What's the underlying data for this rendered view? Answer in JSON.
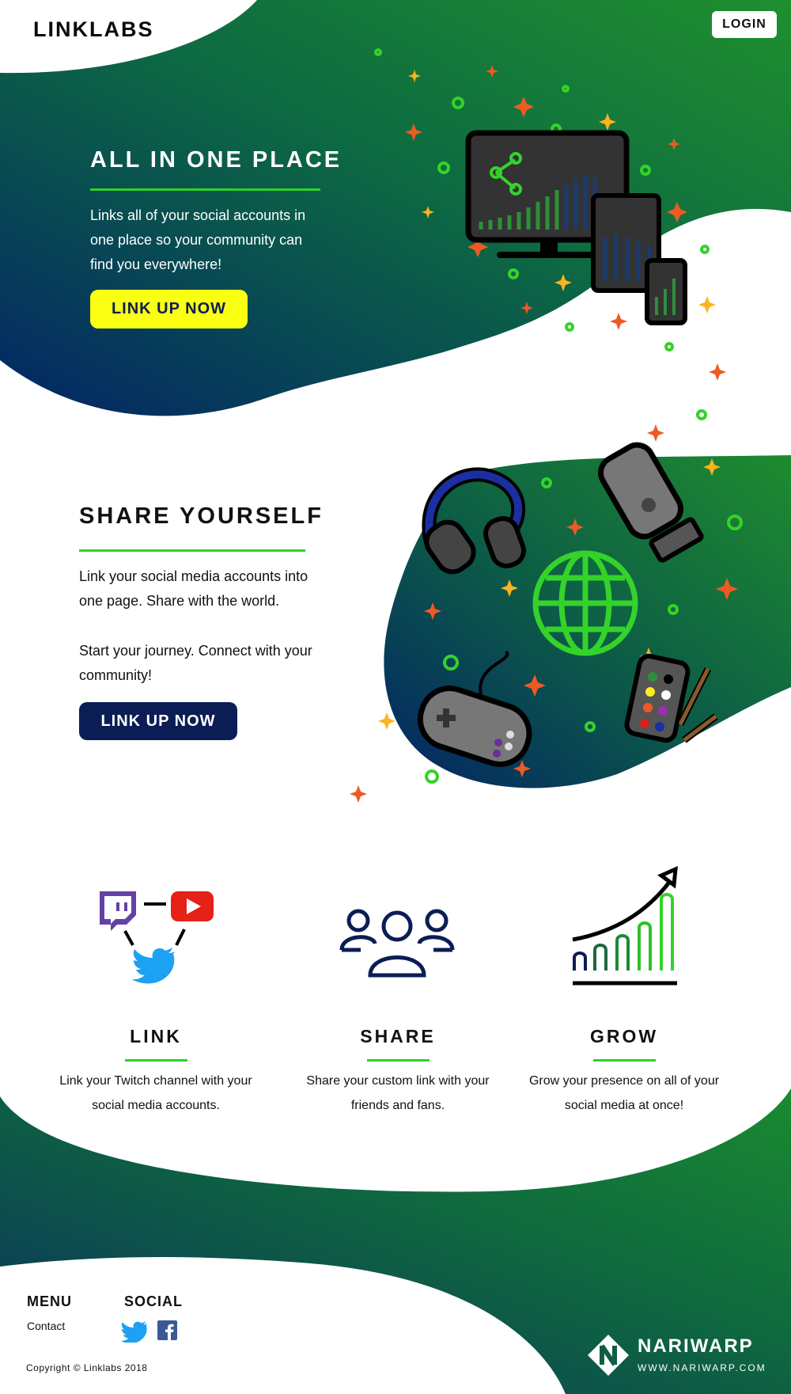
{
  "header": {
    "brand": "LINKLABS",
    "login_label": "LOGIN"
  },
  "hero": {
    "title": "ALL IN ONE PLACE",
    "text": "Links all of your social accounts in one place so your community can find you everywhere!",
    "button": "LINK UP NOW"
  },
  "share": {
    "title": "SHARE YOURSELF",
    "text1": "Link your social media accounts into one page. Share with the world.",
    "text2": "Start your journey. Connect with your community!",
    "button": "LINK UP NOW"
  },
  "features": [
    {
      "title": "LINK",
      "text": "Link your Twitch channel with your social media accounts."
    },
    {
      "title": "SHARE",
      "text": "Share your custom link with your friends and fans."
    },
    {
      "title": "GROW",
      "text": "Grow your presence on all of your social media at once!"
    }
  ],
  "footer": {
    "menu_heading": "MENU",
    "menu_items": [
      "Contact"
    ],
    "social_heading": "SOCIAL",
    "copyright": "Copyright © Linklabs 2018",
    "partner_name": "NARIWARP",
    "partner_url": "WWW.NARIWARP.COM"
  },
  "colors": {
    "accent_green": "#2ed12a",
    "navy": "#0b1d55",
    "yellow_button": "#fbff12",
    "gradient_dark": "#032466",
    "gradient_light": "#1f8f2e"
  },
  "icons": [
    "twitch-icon",
    "youtube-icon",
    "twitter-icon",
    "users-icon",
    "growth-chart-icon",
    "facebook-icon",
    "nariwarp-logo"
  ]
}
